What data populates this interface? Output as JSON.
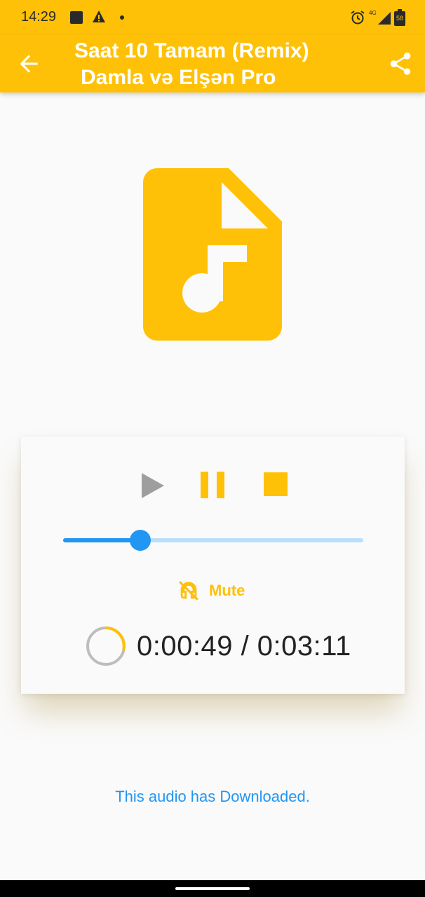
{
  "status_bar": {
    "time": "14:29",
    "network": "4G",
    "battery": "58",
    "icons": [
      "notification-square-icon",
      "warning-icon",
      "dot-icon",
      "alarm-icon",
      "signal-icon",
      "battery-icon"
    ]
  },
  "app_bar": {
    "title_line1": "Saat 10 Tamam (Remix)",
    "title_line2": "Damla və Elşən Pro",
    "back_icon": "arrow-back-icon",
    "share_icon": "share-icon"
  },
  "media": {
    "icon": "audio-file-icon"
  },
  "player": {
    "controls": [
      "play-icon",
      "pause-icon",
      "stop-icon"
    ],
    "progress_fraction": 0.256,
    "mute_label": "Mute",
    "mute_icon": "headset-off-icon",
    "elapsed": "0:00:49",
    "separator": "/",
    "duration": "0:03:11",
    "time_display": "0:00:49 / 0:03:11"
  },
  "download_note": "This audio has Downloaded.",
  "colors": {
    "accent": "#ffc107",
    "blue": "#2196f3",
    "light_blue": "#bbdefb",
    "grey_control": "#9e9e9e"
  }
}
